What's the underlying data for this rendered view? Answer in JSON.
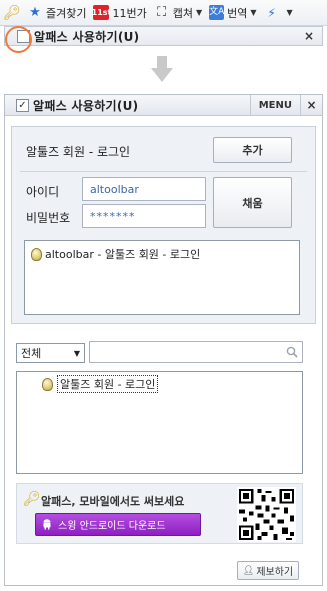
{
  "browser_toolbar": {
    "favorites_label": "즐겨찾기",
    "eleven_st_label": "11번가",
    "eleven_st_icon_text": "11st",
    "capture_label": "캡쳐",
    "translate_label": "번역",
    "translate_icon_text": "文A"
  },
  "collapsed_panel": {
    "title": "알패스 사용하기(U)",
    "close": "×"
  },
  "panel": {
    "title": "알패스 사용하기(U)",
    "menu_label": "MENU",
    "close": "×",
    "check_mark": "✓"
  },
  "login": {
    "site_title": "알툴즈 회원 - 로그인",
    "add_button": "추가",
    "id_label": "아이디",
    "id_value": "altoolbar",
    "password_label": "비밀번호",
    "password_value": "*******",
    "fill_button": "채움",
    "accounts": [
      {
        "label": "altoolbar - 알툴즈 회원 - 로그인"
      }
    ]
  },
  "filter": {
    "selected": "전체",
    "search_placeholder": ""
  },
  "site_list": [
    {
      "label": "알툴즈 회원 - 로그인"
    }
  ],
  "promo": {
    "text": "알패스, 모바일에서도 써보세요",
    "android_button": "스윙 안드로이드 다운로드"
  },
  "report_button": "제보하기",
  "colors": {
    "accent_orange": "#ee7b3e",
    "android_purple": "#9b2fd0",
    "input_text_blue": "#3f66a8"
  }
}
